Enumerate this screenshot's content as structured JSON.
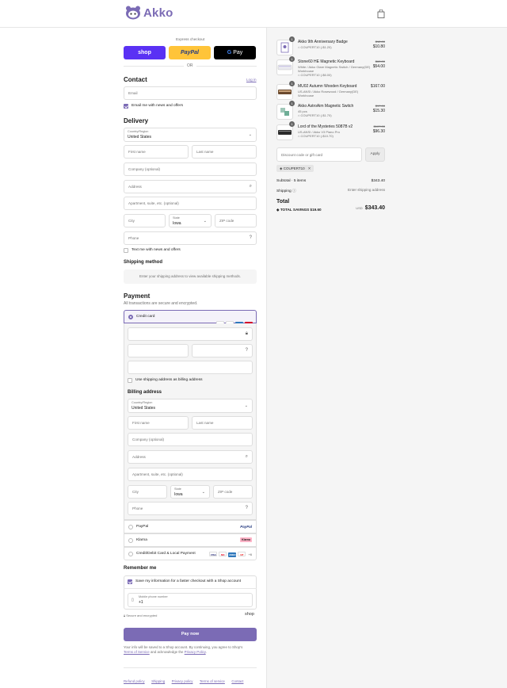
{
  "brand": {
    "name": "Akko",
    "color": "#7b6bb5"
  },
  "header": {
    "cart_icon": "shopping-bag-icon"
  },
  "express": {
    "label": "Express checkout",
    "shop": "shop",
    "paypal": "PayPal",
    "gpay_g": "G",
    "gpay": "Pay",
    "or": "OR"
  },
  "contact": {
    "title": "Contact",
    "login": "Log in",
    "email_placeholder": "Email",
    "email_news": "Email me with news and offers"
  },
  "delivery": {
    "title": "Delivery",
    "country_label": "Country/Region",
    "country": "United States",
    "first": "First name",
    "last": "Last name",
    "company": "Company (optional)",
    "address": "Address",
    "apartment": "Apartment, suite, etc. (optional)",
    "city": "City",
    "state_label": "State",
    "state": "Iowa",
    "zip": "ZIP code",
    "phone": "Phone",
    "text_news": "Text me with news and offers"
  },
  "shipping": {
    "title": "Shipping method",
    "note": "Enter your shipping address to view available shipping methods."
  },
  "payment": {
    "title": "Payment",
    "subtitle": "All transactions are secure and encrypted.",
    "credit_card": "Credit card",
    "use_shipping": "Use shipping address as billing address",
    "billing_title": "Billing address",
    "paypal": "PayPal",
    "klarna": "Klarna",
    "local": "Credit/Debit Card & Local Payment",
    "more_cards": "+6",
    "cards": {
      "visa": "VISA",
      "mc": "MC",
      "amex": "AMEX",
      "unionpay": "UP"
    }
  },
  "remember": {
    "title": "Remember me",
    "save": "Save my information for a faster checkout with a Shop account",
    "mobile_label": "Mobile phone number",
    "mobile_value": "+1",
    "secure": "Secure and encrypted",
    "shop": "shop"
  },
  "pay_button": "Pay now",
  "legal": {
    "line1": "Your info will be saved to a Shop account. By continuing, you agree to Shop's",
    "tos": "Terms of Service",
    "and": "and acknowledge the",
    "privacy": "Privacy Policy",
    "dot": "."
  },
  "footer": [
    "Refund policy",
    "Shipping",
    "Privacy policy",
    "Terms of service",
    "Contact"
  ],
  "cart": {
    "items": [
      {
        "qty": "1",
        "name": "Akko 9th Anniversary Badge",
        "sub": [
          "COUPERT10 (-$1.20)"
        ],
        "old": "$12.00",
        "price": "$10.80"
      },
      {
        "qty": "1",
        "name": "Stone60 HE Magnetic Keyboard",
        "sub": [
          "White / Akko Glare Magnetic Switch / Germany(DE)",
          "Workhouse",
          "COUPERT10 (-$6.00)"
        ],
        "old": "$60.00",
        "price": "$54.00"
      },
      {
        "qty": "1",
        "name": "MU02 Autumn Wooden Keyboard",
        "sub": [
          "US-ANSI / Akko Rosewood / Germany(DE)",
          "Workhouse"
        ],
        "old": "",
        "price": "$167.00"
      },
      {
        "qty": "1",
        "name": "Akko AstroAim Magnetic Switch",
        "sub": [
          "45 pcs",
          "COUPERT10 (-$1.70)"
        ],
        "old": "$17.00",
        "price": "$15.30"
      },
      {
        "qty": "1",
        "name": "Lord of the Mysteries 5087B v2",
        "sub": [
          "US-ANSI / Akko V3 Piano Pro",
          "COUPERT10 (-$10.70)"
        ],
        "old": "$107.00",
        "price": "$96.30"
      }
    ],
    "discount_placeholder": "Discount code or gift card",
    "apply": "Apply",
    "coupon": "COUPERT10",
    "subtotal_label": "Subtotal · 5 items",
    "subtotal": "$343.40",
    "shipping_label": "Shipping",
    "shipping_value": "Enter shipping address",
    "total_label": "Total",
    "currency": "USD",
    "total": "$343.40",
    "savings_label": "TOTAL SAVINGS",
    "savings": "$19.60"
  }
}
